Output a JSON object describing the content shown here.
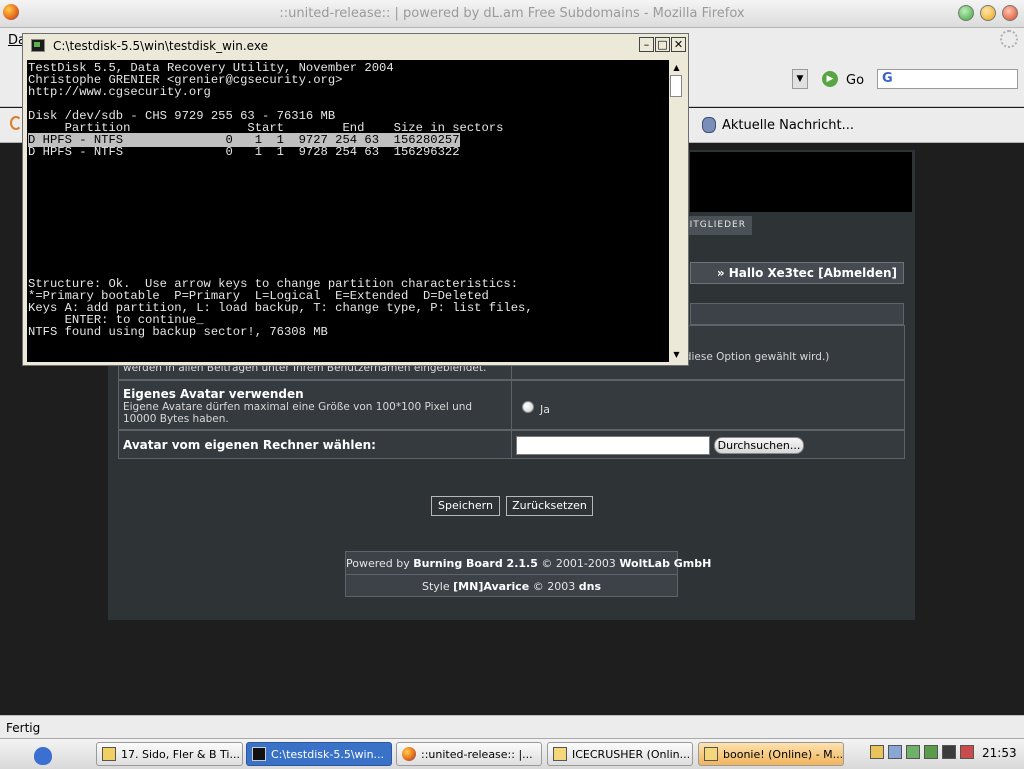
{
  "firefox": {
    "title": "::united-release:: | powered by dL.am Free Subdomains - Mozilla Firefox",
    "menu_first": "Da",
    "go_label": "Go",
    "search_letter": "G",
    "bookmark_news": "Aktuelle Nachricht...",
    "status": "Fertig"
  },
  "forum": {
    "members_tab": "MITGLIEDER",
    "hello_prefix": "» Hallo Xe3tec ",
    "logout": "[Abmelden]",
    "row1_desc": "werden in allen Beiträgen unter Ihrem Benutzernamen eingeblendet.",
    "row1_right": "Avatare gelöscht werden, wenn diese Option gewählt wird.)",
    "own_avatar_label": "Eigenes Avatar verwenden",
    "own_avatar_desc": "Eigene Avatare dürfen maximal eine Größe von 100*100 Pixel und 10000 Bytes haben.",
    "radio_label": "Ja",
    "choose_label": "Avatar vom eigenen Rechner wählen:",
    "browse": "Durchsuchen...",
    "save": "Speichern",
    "reset": "Zurücksetzen",
    "footer1_prefix": "Powered by ",
    "footer1_product": "Burning Board 2.1.5",
    "footer1_mid": " © 2001-2003 ",
    "footer1_company": "WoltLab GmbH",
    "footer2_prefix": "Style ",
    "footer2_style": "[MN]Avarice",
    "footer2_mid": " © 2003 ",
    "footer2_author": "dns"
  },
  "console": {
    "title": "C:\\testdisk-5.5\\win\\testdisk_win.exe",
    "line1": "TestDisk 5.5, Data Recovery Utility, November 2004",
    "line2": "Christophe GRENIER <grenier@cgsecurity.org>",
    "line3": "http://www.cgsecurity.org",
    "line4": "",
    "line5": "Disk /dev/sdb - CHS 9729 255 63 - 76316 MB",
    "header": "     Partition                Start        End    Size in sectors",
    "row_selected": "D HPFS - NTFS              0   1  1  9727 254 63  156280257",
    "row2": "D HPFS - NTFS              0   1  1  9728 254 63  156296322",
    "help1": "Structure: Ok.  Use arrow keys to change partition characteristics:",
    "help2": "*=Primary bootable  P=Primary  L=Logical  E=Extended  D=Deleted",
    "help3": "Keys A: add partition, L: load backup, T: change type, P: list files,",
    "help4": "     ENTER: to continue_",
    "help5": "NTFS found using backup sector!, 76308 MB"
  },
  "taskbar": {
    "tasks": [
      "17. Sido, Fler & B Ti...",
      "C:\\testdisk-5.5\\win...",
      "::united-release:: |...",
      "ICECRUSHER (Onlin...",
      "boonie! (Online) - M..."
    ],
    "clock": "21:53"
  }
}
